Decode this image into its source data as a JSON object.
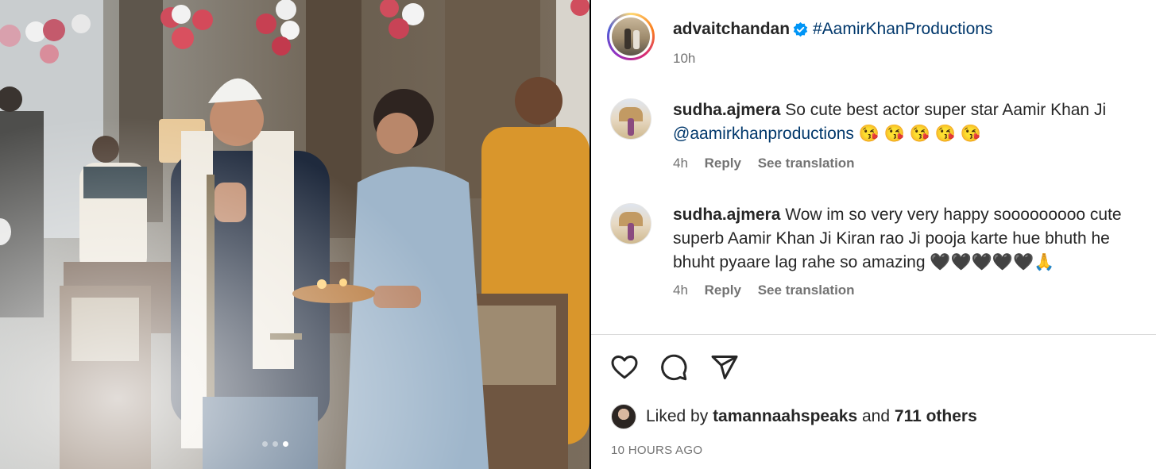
{
  "post": {
    "username": "advaitchandan",
    "hashtag": "#AamirKhanProductions",
    "time_ago": "10h",
    "carousel_position": {
      "current": 3,
      "total": 3
    }
  },
  "comments": [
    {
      "username": "sudha.ajmera",
      "text_line1": "So cute best actor super star Aamir Khan Ji",
      "mention": "@aamirkhanproductions",
      "emojis": "😘 😘 😘 😘 😘",
      "time": "4h",
      "reply_label": "Reply",
      "translate_label": "See translation"
    },
    {
      "username": "sudha.ajmera",
      "text_line1": "Wow im so very very happy sooooooooo cute",
      "text_line2": "superb Aamir Khan Ji Kiran rao Ji pooja karte hue bhuth he",
      "text_line3": "bhuht pyaare lag rahe so amazing",
      "emojis": "🖤🖤🖤🖤🖤🙏",
      "time": "4h",
      "reply_label": "Reply",
      "translate_label": "See translation"
    }
  ],
  "actions": {
    "like_icon": "heart-icon",
    "comment_icon": "comment-icon",
    "share_icon": "send-icon"
  },
  "likes": {
    "prefix": "Liked by",
    "user": "tamannaahspeaks",
    "and": "and",
    "others": "711 others"
  },
  "posted_label": "10 HOURS AGO",
  "colors": {
    "link": "#00376b",
    "verified": "#0095f6",
    "muted": "#737373"
  }
}
